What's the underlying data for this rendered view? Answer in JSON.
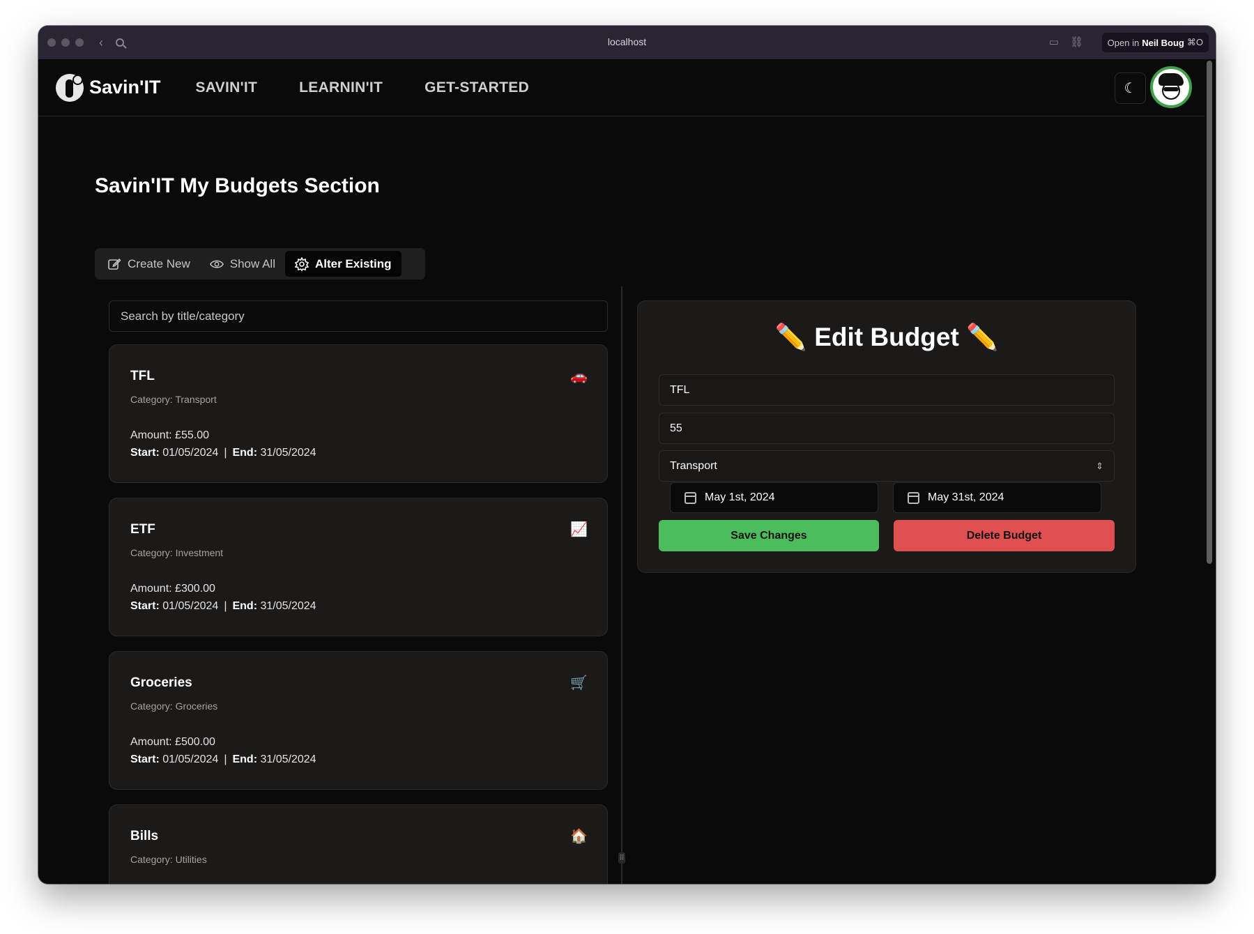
{
  "browser": {
    "url": "localhost",
    "open_in_prefix": "Open in",
    "open_in_user": "Neil Boug",
    "open_in_shortcut": "⌘O"
  },
  "header": {
    "logo_text": "Savin'IT",
    "nav": [
      "SAVIN'IT",
      "LEARNIN'IT",
      "GET-STARTED"
    ],
    "theme_icon": "moon-icon"
  },
  "page": {
    "title": "Savin'IT My Budgets Section"
  },
  "tabs": [
    {
      "label": "Create New",
      "icon": "edit-icon",
      "active": false
    },
    {
      "label": "Show All",
      "icon": "eye-icon",
      "active": false
    },
    {
      "label": "Alter Existing",
      "icon": "settings-icon",
      "active": true
    }
  ],
  "search": {
    "placeholder": "Search by title/category"
  },
  "labels": {
    "amount": "Amount:",
    "start": "Start:",
    "end": "End:",
    "separator": "|"
  },
  "budgets": [
    {
      "title": "TFL",
      "emoji": "🚗",
      "category": "Category: Transport",
      "amount": "£55.00",
      "start": "01/05/2024",
      "end": "31/05/2024"
    },
    {
      "title": "ETF",
      "emoji": "📈",
      "category": "Category: Investment",
      "amount": "£300.00",
      "start": "01/05/2024",
      "end": "31/05/2024"
    },
    {
      "title": "Groceries",
      "emoji": "🛒",
      "category": "Category: Groceries",
      "amount": "£500.00",
      "start": "01/05/2024",
      "end": "31/05/2024"
    },
    {
      "title": "Bills",
      "emoji": "🏠",
      "category": "Category: Utilities",
      "amount": "",
      "start": "",
      "end": ""
    }
  ],
  "edit_form": {
    "title": "✏️ Edit Budget ✏️",
    "title_value": "TFL",
    "amount_value": "55",
    "category_value": "Transport",
    "start_date": "May 1st, 2024",
    "end_date": "May 31st, 2024",
    "save_label": "Save Changes",
    "delete_label": "Delete Budget"
  },
  "colors": {
    "save": "#4cbd5c",
    "delete": "#e05050",
    "avatar_ring": "#3fa14a"
  }
}
